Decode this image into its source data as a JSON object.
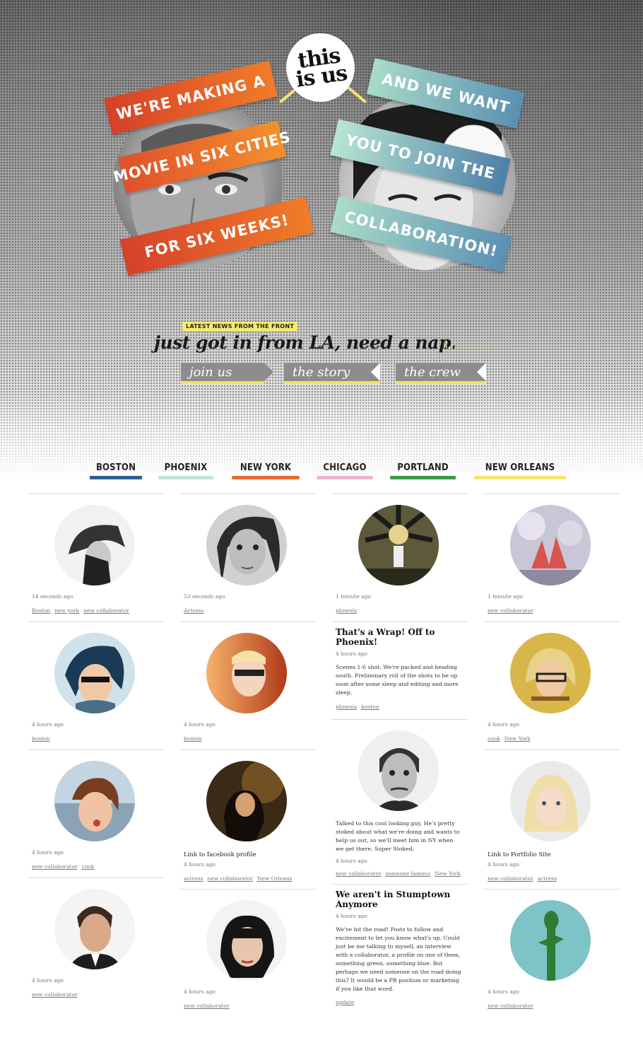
{
  "logo": {
    "text": "this\nis us"
  },
  "ribbons_left": [
    "WE'RE MAKING A",
    "MOVIE IN SIX CITIES",
    "FOR SIX WEEKS!"
  ],
  "ribbons_right": [
    "AND WE WANT",
    "YOU TO JOIN THE",
    "COLLABORATION!"
  ],
  "news": {
    "tag": "LATEST NEWS FROM THE FRONT",
    "headline": "just got in from LA, need a nap."
  },
  "nav": [
    {
      "label": "join us"
    },
    {
      "label": "the story"
    },
    {
      "label": "the crew"
    }
  ],
  "cities": [
    {
      "label": "BOSTON",
      "color": "#2f5f95"
    },
    {
      "label": "PHOENIX",
      "color": "#bfe3d6"
    },
    {
      "label": "NEW YORK",
      "color": "#ea6a2f"
    },
    {
      "label": "CHICAGO",
      "color": "#eeb3cf"
    },
    {
      "label": "PORTLAND",
      "color": "#3a9a46"
    },
    {
      "label": "NEW ORLEANS",
      "color": "#f5e56d"
    }
  ],
  "columns": [
    {
      "cards": [
        {
          "time": "14 seconds ago",
          "tags": [
            "Boston",
            "new york",
            "new collaborator"
          ]
        },
        {
          "time": "4 hours ago",
          "tags": [
            "boston"
          ]
        },
        {
          "time": "4 hours ago",
          "tags": [
            "new collaborator",
            "cook"
          ]
        },
        {
          "time": "4 hours ago",
          "tags": [
            "new collaborator"
          ]
        }
      ]
    },
    {
      "cards": [
        {
          "time": "53 seconds ago",
          "tags": [
            "Actress"
          ]
        },
        {
          "time": "4 hours ago",
          "tags": [
            "boston"
          ]
        },
        {
          "label": "Link to facebook profile",
          "time": "4 hours ago",
          "tags": [
            "actress",
            "new collaborator",
            "New Orleans"
          ]
        },
        {
          "time": "4 hours ago",
          "tags": [
            "new collaborator"
          ]
        }
      ]
    },
    {
      "cards": [
        {
          "time": "1 minute ago",
          "tags": [
            "phoenix"
          ]
        },
        {
          "title": "That's a Wrap! Off to Phoenix!",
          "time": "4 hours ago",
          "body": "Scenes 1-6 shot. We're packed and heading south. Preliminary roll of the shots to be up soon after some sleep and editing and more sleep.",
          "tags": [
            "phoenix",
            "boston"
          ]
        },
        {
          "body": "Talked to this cool looking guy. He's pretty stoked about what we're doing and wants to help us out, so we'll meet him in NY when we get there. Super Stoked.",
          "time": "4 hours ago",
          "tags": [
            "new collaborator",
            "someone famous",
            "New York"
          ]
        },
        {
          "title": "We aren't in Stumptown Anymore",
          "time": "4 hours ago",
          "body": "We've hit the road! Posts to follow and excitement to let you know what's up. Could just be me talking to myself, an interview with a collaborator, a profile on one of them, something green, something blue. But perhaps we need someone on the road doing this? It would be a PR position or marketing if you like that word.",
          "tags": [
            "update"
          ]
        }
      ]
    },
    {
      "cards": [
        {
          "time": "1 minute ago",
          "tags": [
            "new collaborator"
          ]
        },
        {
          "time": "4 hours ago",
          "tags": [
            "cook",
            "New York"
          ]
        },
        {
          "label": "Link to Portfolio Site",
          "time": "4 hours ago",
          "tags": [
            "new collaborator",
            "actress"
          ]
        },
        {
          "time": "4 hours ago",
          "tags": [
            "new collaborator"
          ]
        }
      ]
    }
  ]
}
